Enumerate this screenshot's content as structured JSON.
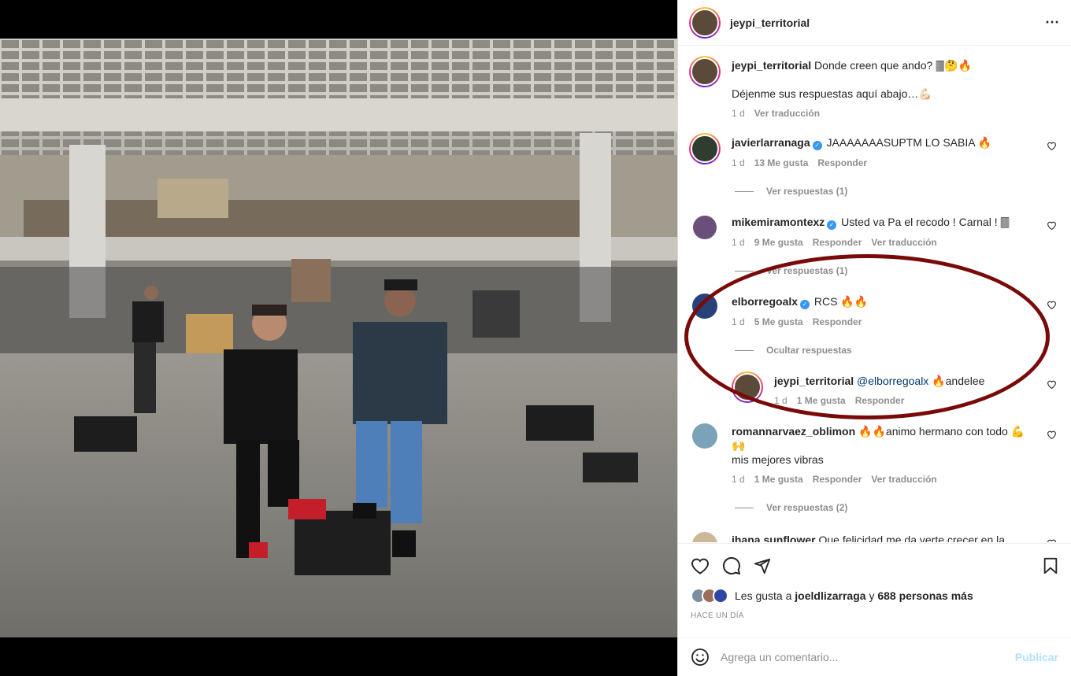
{
  "post": {
    "author": "jeypi_territorial",
    "more_icon": "⋯"
  },
  "caption": {
    "user": "jeypi_territorial",
    "text": "Donde creen que ando? 🀫🤔🔥",
    "text2": "Déjenme sus respuestas aquí abajo…💪🏻",
    "time": "1 d",
    "translate": "Ver traducción"
  },
  "comments": [
    {
      "user": "javierlarranaga",
      "verified": true,
      "text": "JAAAAAAASUPTM LO SABIA 🔥",
      "time": "1 d",
      "likes": "13 Me gusta",
      "reply": "Responder",
      "replies": "Ver respuestas (1)"
    },
    {
      "user": "mikemiramontexz",
      "verified": true,
      "text": "Usted va Pa el recodo ! Carnal ! 🀫",
      "time": "1 d",
      "likes": "9 Me gusta",
      "reply": "Responder",
      "translate": "Ver traducción",
      "replies": "Ver respuestas (1)"
    },
    {
      "user": "elborregoalx",
      "verified": true,
      "text": "RCS 🔥🔥",
      "time": "1 d",
      "likes": "5 Me gusta",
      "reply": "Responder",
      "replies": "Ocultar respuestas"
    },
    {
      "user": "jeypi_territorial",
      "mention": "@elborregoalx",
      "text": "🔥andelee",
      "time": "1 d",
      "likes": "1 Me gusta",
      "reply": "Responder"
    },
    {
      "user": "romannarvaez_oblimon",
      "text": "🔥🔥animo hermano con todo 💪🙌",
      "text2": "mis mejores vibras",
      "time": "1 d",
      "likes": "1 Me gusta",
      "reply": "Responder",
      "translate": "Ver traducción",
      "replies": "Ver respuestas (2)"
    },
    {
      "user": "ihana.sunflower",
      "text": "Que felicidad me da verte crecer en la"
    }
  ],
  "likes_line": {
    "prefix": "Les gusta a",
    "user": "joeldlizarraga",
    "and": "y",
    "others": "688 personas más"
  },
  "timestamp": "Hace un día",
  "composer": {
    "placeholder": "Agrega un comentario...",
    "publish": "Publicar"
  },
  "colors": {
    "annotation_oval": "#7a0a0a",
    "verified": "#3897f0",
    "publish_disabled": "#b2dffc"
  }
}
